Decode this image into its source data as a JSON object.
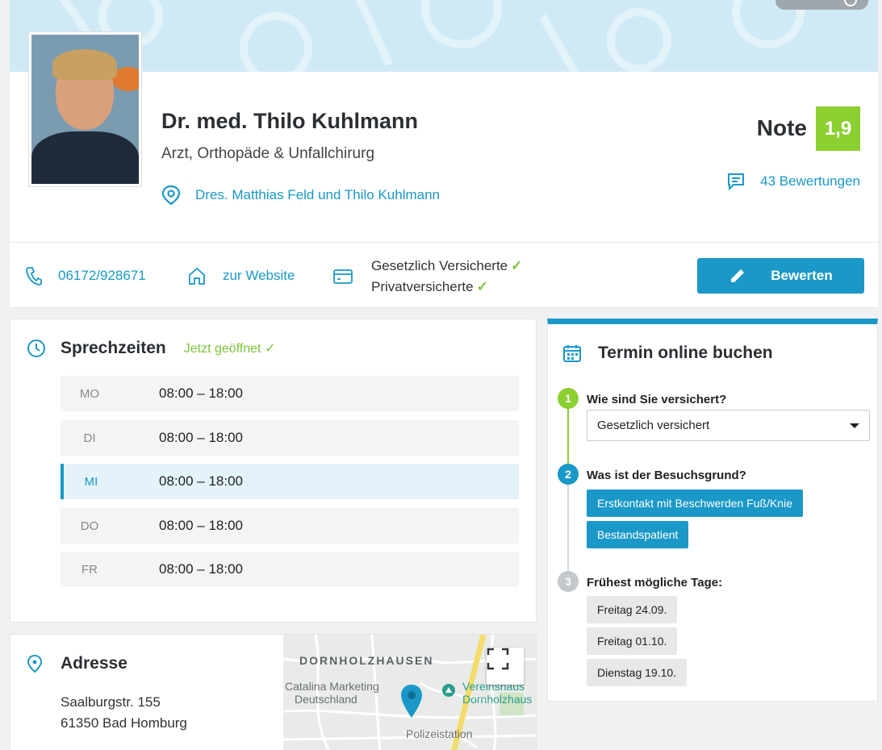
{
  "doctor": {
    "name": "Dr. med. Thilo Kuhlmann",
    "specialty": "Arzt, Orthopäde & Unfallchirurg",
    "practice": "Dres. Matthias Feld und Thilo Kuhlmann"
  },
  "rating": {
    "label": "Note",
    "grade": "1,9",
    "reviews_label": "43 Bewertungen",
    "badge_color": "#8ccf30"
  },
  "contact": {
    "phone": "06172/928671",
    "website_label": "zur Website",
    "insurance_statutory": "Gesetzlich Versicherte",
    "insurance_private": "Privatversicherte",
    "check_glyph": "✓",
    "rate_button": "Bewerten"
  },
  "hours": {
    "title": "Sprechzeiten",
    "status": "Jetzt geöffnet",
    "status_check": "✓",
    "days": [
      {
        "day": "MO",
        "time": "08:00 – 18:00"
      },
      {
        "day": "DI",
        "time": "08:00 – 18:00"
      },
      {
        "day": "MI",
        "time": "08:00 – 18:00"
      },
      {
        "day": "DO",
        "time": "08:00 – 18:00"
      },
      {
        "day": "FR",
        "time": "08:00 – 18:00"
      }
    ]
  },
  "address": {
    "title": "Adresse",
    "street": "Saalburgstr. 155",
    "city": "61350 Bad Homburg",
    "map_labels": {
      "district": "DORNHOLZHAUSEN",
      "place1_line1": "Catalina Marketing",
      "place1_line2": "Deutschland",
      "place2_line1": "Vereinshaus",
      "place2_line2": "Dornholzhaus",
      "place3": "Polizeistation"
    }
  },
  "booking": {
    "title": "Termin online buchen",
    "step1": {
      "num": "1",
      "label": "Wie sind Sie versichert?",
      "selected": "Gesetzlich versichert"
    },
    "step2": {
      "num": "2",
      "label": "Was ist der Besuchsgrund?",
      "options": [
        "Erstkontakt mit Beschwerden Fuß/Knie",
        "Bestandspatient"
      ]
    },
    "step3": {
      "num": "3",
      "label": "Frühest mögliche Tage:",
      "days": [
        "Freitag 24.09.",
        "Freitag 01.10.",
        "Dienstag 19.10."
      ]
    }
  },
  "colors": {
    "accent": "#1a98c7",
    "success": "#7dc43a",
    "step_done": "#8ccf30",
    "step_pending": "#c3c8cc"
  }
}
